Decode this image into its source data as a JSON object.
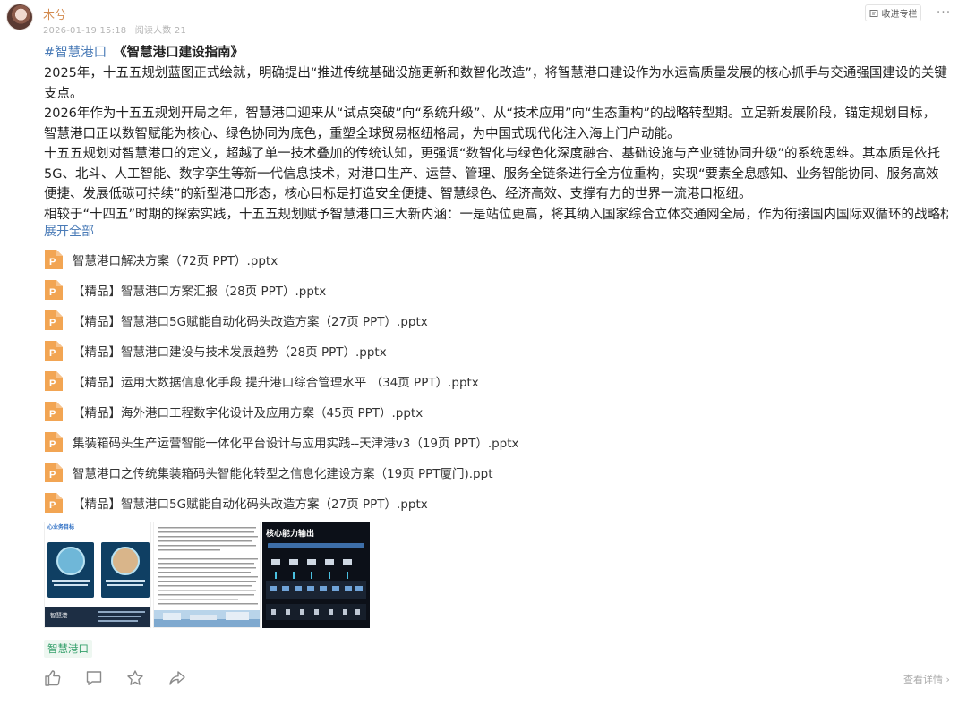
{
  "author": {
    "name": "木兮",
    "date": "2026-01-19 15:18",
    "read_count": "阅读人数 21"
  },
  "header": {
    "collect_label": "收进专栏",
    "more_label": "···"
  },
  "headline": {
    "hashtag": "#智慧港口",
    "book_title": "《智慧港口建设指南》"
  },
  "content": {
    "paragraphs": [
      "2025年，十五五规划蓝图正式绘就，明确提出“推进传统基础设施更新和数智化改造”，将智慧港口建设作为水运高质量发展的核心抓手与交通强国建设的关键支点。",
      "2026年作为十五五规划开局之年，智慧港口迎来从“试点突破”向“系统升级”、从“技术应用”向“生态重构”的战略转型期。立足新发展阶段，锚定规划目标，智慧港口正以数智赋能为核心、绿色协同为底色，重塑全球贸易枢纽格局，为中国式现代化注入海上门户动能。",
      "十五五规划对智慧港口的定义，超越了单一技术叠加的传统认知，更强调“数智化与绿色化深度融合、基础设施与产业链协同升级”的系统思维。其本质是依托5G、北斗、人工智能、数字孪生等新一代信息技术，对港口生产、运营、管理、服务全链条进行全方位重构，实现“要素全息感知、业务智能协同、服务高效便捷、发展低碳可持续”的新型港口形态，核心目标是打造安全便捷、智慧绿色、经济高效、支撑有力的世界一流港口枢纽。",
      "相较于“十四五”时期的探索实践，十五五规划赋予智慧港口三大新内涵：一是站位更高，将其纳入国家综合立体交通网全局，作为衔接国内国际双循环的战略枢纽；二"
    ],
    "expand_label": "展开全部"
  },
  "attachments": [
    "智慧港口解决方案（72页 PPT）.pptx",
    "【精品】智慧港口方案汇报（28页 PPT）.pptx",
    "【精品】智慧港口5G赋能自动化码头改造方案（27页 PPT）.pptx",
    "【精品】智慧港口建设与技术发展趋势（28页 PPT）.pptx",
    "【精品】运用大数据信息化手段 提升港口综合管理水平 （34页 PPT）.pptx",
    "【精品】海外港口工程数字化设计及应用方案（45页 PPT）.pptx",
    "集装箱码头生产运营智能一体化平台设计与应用实践--天津港v3（19页 PPT）.pptx",
    "智慧港口之传统集装箱码头智能化转型之信息化建设方案（19页 PPT厦门).ppt",
    "【精品】智慧港口5G赋能自动化码头改造方案（27页 PPT）.pptx"
  ],
  "thumbnails": {
    "t1_title": "心业务目标",
    "t1_caption": "智慧港",
    "t3_title": "核心能力输出"
  },
  "tag": "智慧港口",
  "footer": {
    "view_detail": "查看详情 ›"
  },
  "colors": {
    "author": "#d38a4e",
    "link": "#4a7bb7",
    "tag_text": "#35a06b",
    "ppt_icon": "#f2a553"
  }
}
